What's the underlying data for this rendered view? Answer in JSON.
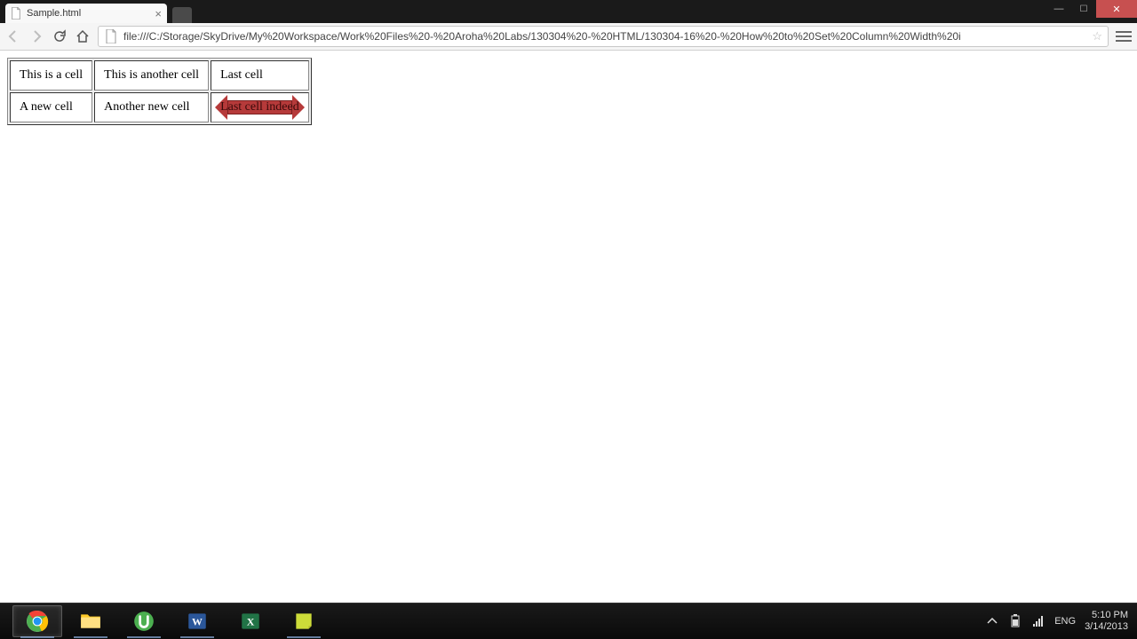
{
  "browser": {
    "tab_title": "Sample.html",
    "url": "file:///C:/Storage/SkyDrive/My%20Workspace/Work%20Files%20-%20Aroha%20Labs/130304%20-%20HTML/130304-16%20-%20How%20to%20Set%20Column%20Width%20i"
  },
  "page": {
    "table": {
      "rows": [
        [
          "This is a cell",
          "This is another cell",
          "Last cell"
        ],
        [
          "A new cell",
          "Another new cell",
          "Last cell indeed"
        ]
      ]
    }
  },
  "taskbar": {
    "apps": [
      "chrome",
      "explorer",
      "utorrent",
      "word",
      "excel",
      "notes"
    ],
    "tray": {
      "lang": "ENG",
      "time": "5:10 PM",
      "date": "3/14/2013"
    }
  }
}
